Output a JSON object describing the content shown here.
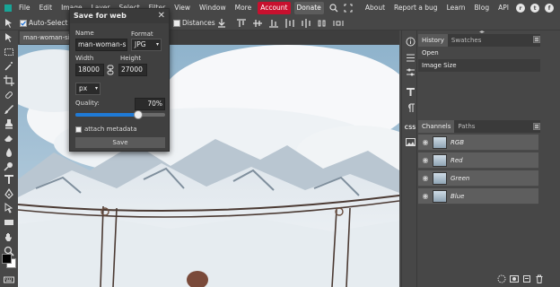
{
  "menubar": {
    "items": [
      "File",
      "Edit",
      "Image",
      "Layer",
      "Select",
      "Filter",
      "View",
      "Window",
      "More"
    ],
    "account": "Account",
    "donate": "Donate",
    "right_links": [
      "About",
      "Report a bug",
      "Learn",
      "Blog",
      "API"
    ],
    "social_icons": [
      "reddit-icon",
      "twitter-icon",
      "facebook-icon"
    ]
  },
  "options": {
    "auto_select_label": "Auto-Select",
    "auto_select_checked": true,
    "distances_label": "Distances",
    "distances_checked": false
  },
  "document": {
    "tab_label": "man-woman-sitti"
  },
  "dialog": {
    "title": "Save for web",
    "name_label": "Name",
    "name_value": "man-woman-sitt",
    "format_label": "Format",
    "format_value": "JPG",
    "width_label": "Width",
    "width_value": "18000",
    "height_label": "Height",
    "height_value": "27000",
    "unit_value": "px",
    "quality_label": "Quality:",
    "quality_value": "70%",
    "quality_fraction": 0.7,
    "attach_label": "attach metadata",
    "save_label": "Save"
  },
  "history": {
    "tab_history": "History",
    "tab_swatches": "Swatches",
    "items": [
      "Open",
      "Image Size"
    ]
  },
  "channels": {
    "tab_channels": "Channels",
    "tab_paths": "Paths",
    "items": [
      "RGB",
      "Red",
      "Green",
      "Blue"
    ]
  },
  "strip": {
    "css_label": "CSS"
  },
  "colors": {
    "accent_account": "#c8102e",
    "panel_bg": "#474747",
    "dialog_bg": "#404040"
  }
}
